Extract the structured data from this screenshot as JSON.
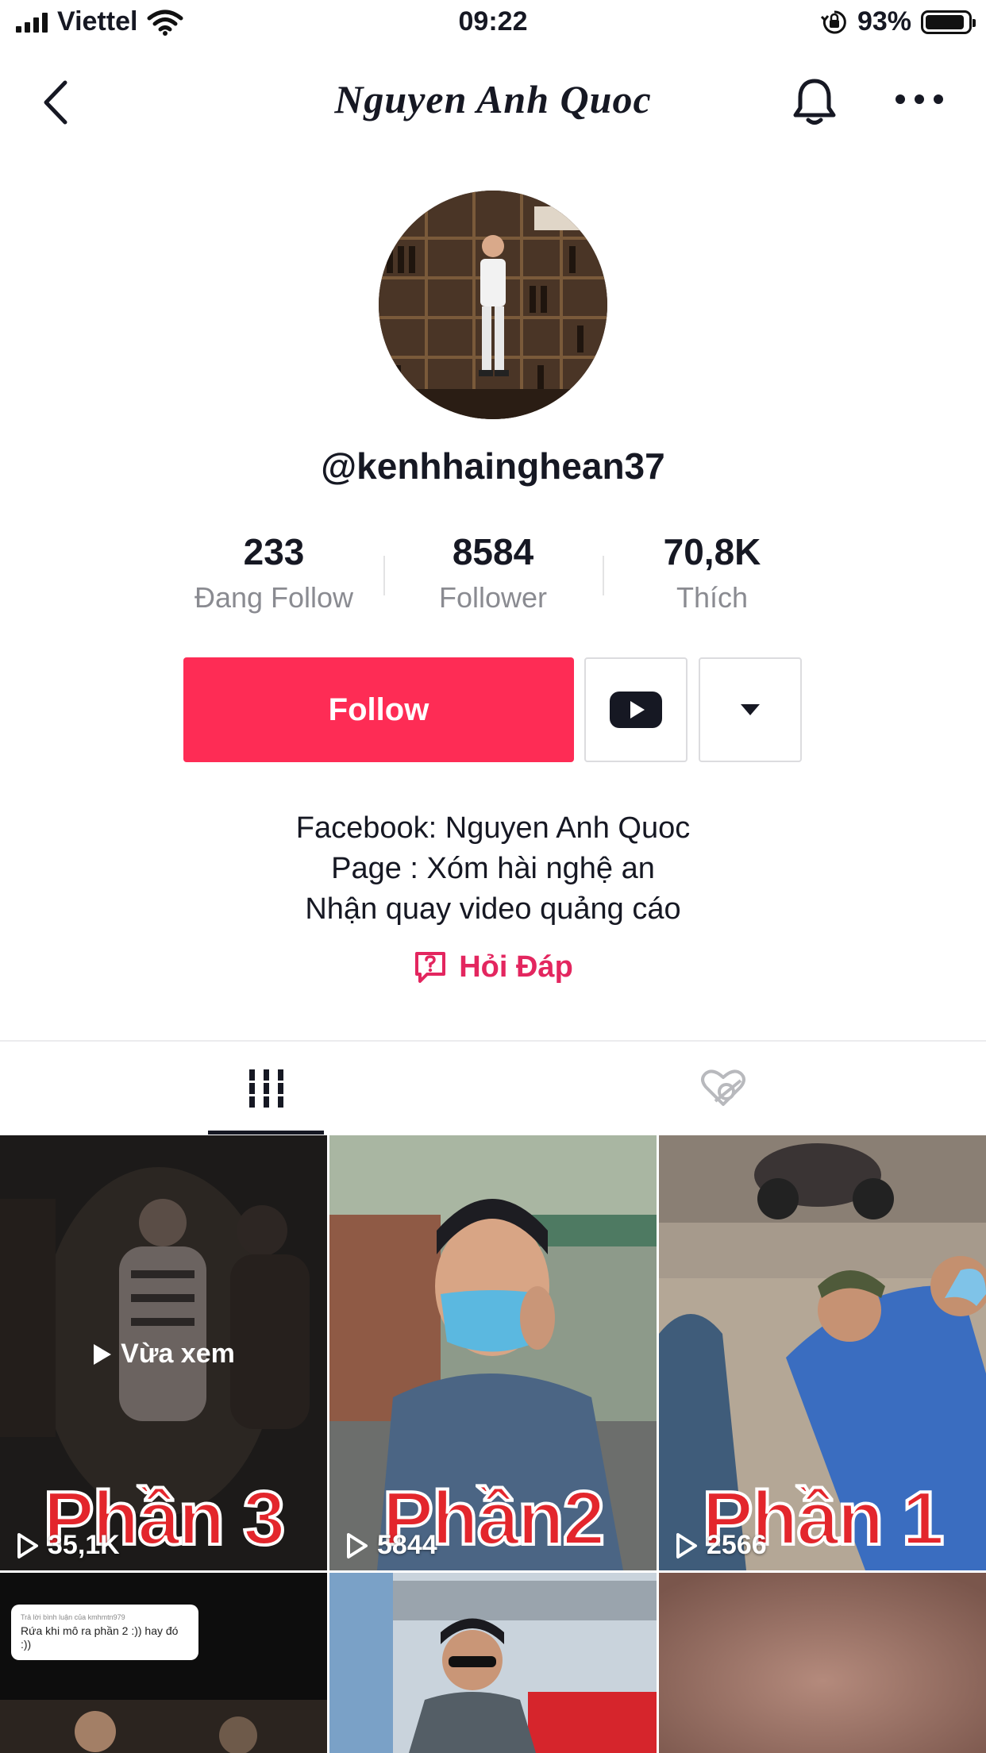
{
  "status_bar": {
    "carrier": "Viettel",
    "time": "09:22",
    "battery": "93%",
    "battery_level": 0.93
  },
  "nav": {
    "title": "Nguyen Anh Quoc",
    "icons": [
      "back-arrow-icon",
      "bell-icon",
      "more-icon"
    ]
  },
  "profile": {
    "handle": "@kenhhainghean37",
    "stats": [
      {
        "value": "233",
        "label": "Đang Follow"
      },
      {
        "value": "8584",
        "label": "Follower"
      },
      {
        "value": "70,8K",
        "label": "Thích"
      }
    ],
    "follow_label": "Follow",
    "bio": [
      "Facebook: Nguyen Anh Quoc",
      "Page : Xóm hài nghệ an",
      "Nhận quay video quảng cáo"
    ],
    "qa_label": "Hỏi Đáp"
  },
  "tabs": [
    "videos-grid-icon",
    "liked-hidden-icon"
  ],
  "videos": [
    {
      "views": "35,1K",
      "caption": "Phần 3",
      "overlay": "Vừa xem"
    },
    {
      "views": "5844",
      "caption": "Phần2"
    },
    {
      "views": "2566",
      "caption": "Phần 1"
    },
    {
      "comment_header": "Trả lời bình luận của kmhmtn979",
      "comment": "Rứa khi mô ra phần 2 :)) hay đó :))"
    },
    {},
    {}
  ],
  "colors": {
    "accent": "#fe2c55",
    "qa": "#e3265f",
    "text": "#161823",
    "muted": "#8a8b91"
  }
}
